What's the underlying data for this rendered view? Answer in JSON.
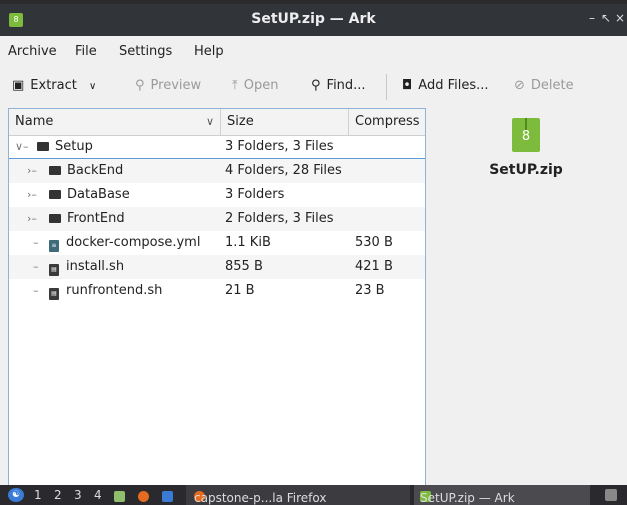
{
  "window": {
    "title": "SetUP.zip — Ark",
    "app_icon_glyph": "8",
    "controls": [
      "–",
      "↖",
      "×"
    ]
  },
  "menu": [
    "Archive",
    "File",
    "Settings",
    "Help"
  ],
  "toolbar": {
    "extract": "Extract",
    "preview": "Preview",
    "open": "Open",
    "find": "Find...",
    "add_files": "Add Files...",
    "delete": "Delete"
  },
  "table": {
    "columns": {
      "name": "Name",
      "size": "Size",
      "compressed": "Compress"
    },
    "rows": [
      {
        "name": "Setup",
        "size": "3 Folders, 3 Files",
        "compressed": "",
        "kind": "folder"
      },
      {
        "name": "BackEnd",
        "size": "4 Folders, 28 Files",
        "compressed": "",
        "kind": "folder"
      },
      {
        "name": "DataBase",
        "size": "3 Folders",
        "compressed": "",
        "kind": "folder"
      },
      {
        "name": "FrontEnd",
        "size": "2 Folders, 3 Files",
        "compressed": "",
        "kind": "folder"
      },
      {
        "name": "docker-compose.yml",
        "size": "1.1 KiB",
        "compressed": "530 B",
        "kind": "file"
      },
      {
        "name": "install.sh",
        "size": "855 B",
        "compressed": "421 B",
        "kind": "script"
      },
      {
        "name": "runfrontend.sh",
        "size": "21 B",
        "compressed": "23 B",
        "kind": "script"
      }
    ]
  },
  "preview": {
    "name": "SetUP.zip",
    "icon_glyph": "8"
  },
  "taskbar": {
    "desktops": [
      "1",
      "2",
      "3",
      "4"
    ],
    "firefox_task": "capstone-p...la Firefox",
    "ark_task": "SetUP.zip — Ark"
  },
  "colors": {
    "accent": "#7dbb3c",
    "titlebar": "#313438",
    "selection": "#5b9bd5",
    "taskbar": "#2a2a2e"
  }
}
